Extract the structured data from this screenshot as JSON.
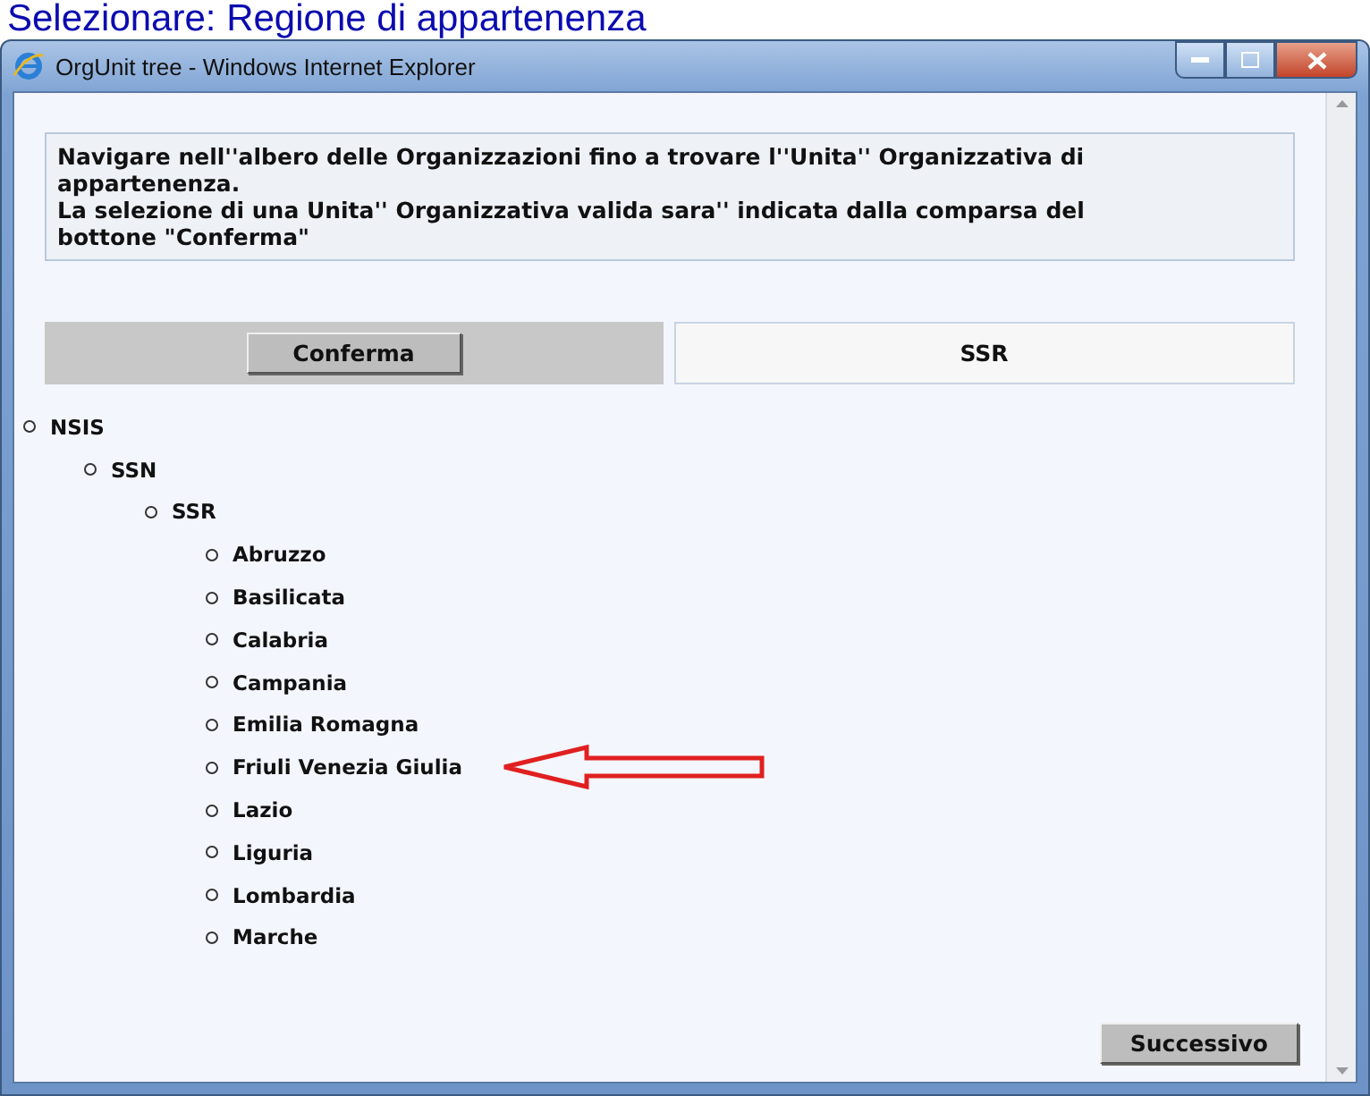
{
  "heading": "Selezionare: Regione di appartenenza",
  "window": {
    "title": "OrgUnit tree - Windows Internet Explorer"
  },
  "instructions": [
    "Navigare nell''albero delle Organizzazioni fino a trovare l''Unita'' Organizzativa di appartenenza.",
    "La selezione di una Unita'' Organizzativa valida sara'' indicata dalla comparsa del bottone \"Conferma\""
  ],
  "confirm_button": "Conferma",
  "selected_unit": "SSR",
  "tree": [
    {
      "label": "NSIS",
      "pointed": false,
      "children": [
        {
          "label": "SSN",
          "pointed": false,
          "children": [
            {
              "label": "SSR",
              "pointed": false,
              "children": [
                {
                  "label": "Abruzzo",
                  "pointed": false
                },
                {
                  "label": "Basilicata",
                  "pointed": false
                },
                {
                  "label": "Calabria",
                  "pointed": false
                },
                {
                  "label": "Campania",
                  "pointed": false
                },
                {
                  "label": "Emilia Romagna",
                  "pointed": false
                },
                {
                  "label": "Friuli Venezia Giulia",
                  "pointed": true
                },
                {
                  "label": "Lazio",
                  "pointed": false
                },
                {
                  "label": "Liguria",
                  "pointed": false
                },
                {
                  "label": "Lombardia",
                  "pointed": false
                },
                {
                  "label": "Marche",
                  "pointed": false
                }
              ]
            }
          ]
        }
      ]
    }
  ],
  "next_button": "Successivo"
}
